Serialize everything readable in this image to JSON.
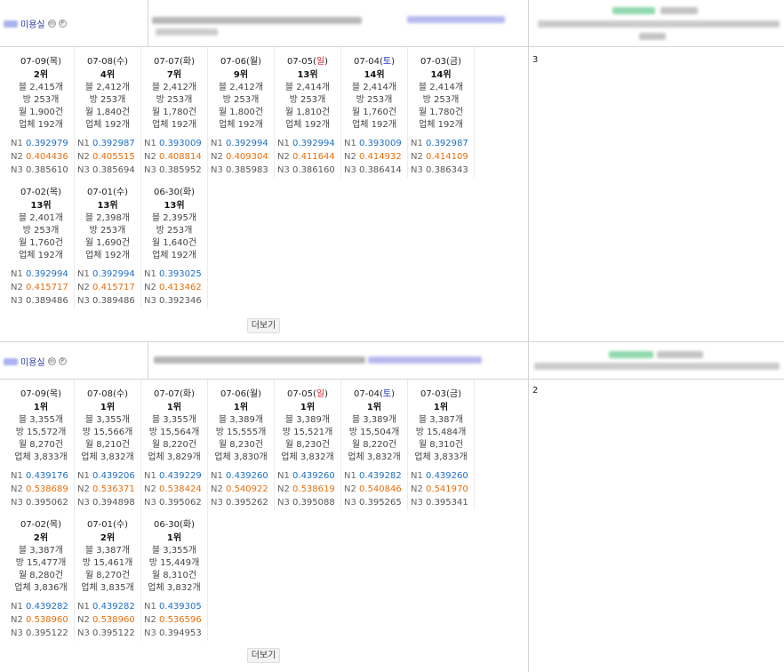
{
  "stores": [
    {
      "name_label": "미용실",
      "badges": [
        "m",
        "P"
      ],
      "right_count": "3",
      "more_label": "더보기",
      "days": [
        {
          "date": "07-09(",
          "wd": "목",
          "close": ")",
          "wd_type": "",
          "rank": "2위",
          "blog": "블 2,415개",
          "bang": "방 253개",
          "month": "월 1,900건",
          "biz": "업체 192개",
          "n1": "0.392979",
          "n2": "0.404436",
          "n3": "0.385610"
        },
        {
          "date": "07-08(",
          "wd": "수",
          "close": ")",
          "wd_type": "",
          "rank": "4위",
          "blog": "블 2,412개",
          "bang": "방 253개",
          "month": "월 1,840건",
          "biz": "업체 192개",
          "n1": "0.392987",
          "n2": "0.405515",
          "n3": "0.385694"
        },
        {
          "date": "07-07(",
          "wd": "화",
          "close": ")",
          "wd_type": "",
          "rank": "7위",
          "blog": "블 2,412개",
          "bang": "방 253개",
          "month": "월 1,780건",
          "biz": "업체 192개",
          "n1": "0.393009",
          "n2": "0.408814",
          "n3": "0.385952"
        },
        {
          "date": "07-06(",
          "wd": "월",
          "close": ")",
          "wd_type": "",
          "rank": "9위",
          "blog": "블 2,412개",
          "bang": "방 253개",
          "month": "월 1,800건",
          "biz": "업체 192개",
          "n1": "0.392994",
          "n2": "0.409304",
          "n3": "0.385983"
        },
        {
          "date": "07-05(",
          "wd": "일",
          "close": ")",
          "wd_type": "sun",
          "rank": "13위",
          "blog": "블 2,414개",
          "bang": "방 253개",
          "month": "월 1,810건",
          "biz": "업체 192개",
          "n1": "0.392994",
          "n2": "0.411644",
          "n3": "0.386160"
        },
        {
          "date": "07-04(",
          "wd": "토",
          "close": ")",
          "wd_type": "sat",
          "rank": "14위",
          "blog": "블 2,414개",
          "bang": "방 253개",
          "month": "월 1,760건",
          "biz": "업체 192개",
          "n1": "0.393009",
          "n2": "0.414932",
          "n3": "0.386414"
        },
        {
          "date": "07-03(",
          "wd": "금",
          "close": ")",
          "wd_type": "",
          "rank": "14위",
          "blog": "블 2,414개",
          "bang": "방 253개",
          "month": "월 1,780건",
          "biz": "업체 192개",
          "n1": "0.392987",
          "n2": "0.414109",
          "n3": "0.386343"
        },
        {
          "date": "07-02(",
          "wd": "목",
          "close": ")",
          "wd_type": "",
          "rank": "13위",
          "blog": "블 2,401개",
          "bang": "방 253개",
          "month": "월 1,760건",
          "biz": "업체 192개",
          "n1": "0.392994",
          "n2": "0.415717",
          "n3": "0.389486"
        },
        {
          "date": "07-01(",
          "wd": "수",
          "close": ")",
          "wd_type": "",
          "rank": "13위",
          "blog": "블 2,398개",
          "bang": "방 253개",
          "month": "월 1,690건",
          "biz": "업체 192개",
          "n1": "0.392994",
          "n2": "0.415717",
          "n3": "0.389486"
        },
        {
          "date": "06-30(",
          "wd": "화",
          "close": ")",
          "wd_type": "",
          "rank": "13위",
          "blog": "블 2,395개",
          "bang": "방 253개",
          "month": "월 1,640건",
          "biz": "업체 192개",
          "n1": "0.393025",
          "n2": "0.413462",
          "n3": "0.392346"
        }
      ]
    },
    {
      "name_label": "미용실",
      "badges": [
        "m",
        "P"
      ],
      "right_count": "2",
      "more_label": "더보기",
      "days": [
        {
          "date": "07-09(",
          "wd": "목",
          "close": ")",
          "wd_type": "",
          "rank": "1위",
          "blog": "블 3,355개",
          "bang": "방 15,572개",
          "month": "월 8,270건",
          "biz": "업체 3,833개",
          "n1": "0.439176",
          "n2": "0.538689",
          "n3": "0.395062"
        },
        {
          "date": "07-08(",
          "wd": "수",
          "close": ")",
          "wd_type": "",
          "rank": "1위",
          "blog": "블 3,355개",
          "bang": "방 15,566개",
          "month": "월 8,210건",
          "biz": "업체 3,832개",
          "n1": "0.439206",
          "n2": "0.536371",
          "n3": "0.394898"
        },
        {
          "date": "07-07(",
          "wd": "화",
          "close": ")",
          "wd_type": "",
          "rank": "1위",
          "blog": "블 3,355개",
          "bang": "방 15,564개",
          "month": "월 8,220건",
          "biz": "업체 3,829개",
          "n1": "0.439229",
          "n2": "0.538424",
          "n3": "0.395062"
        },
        {
          "date": "07-06(",
          "wd": "월",
          "close": ")",
          "wd_type": "",
          "rank": "1위",
          "blog": "블 3,389개",
          "bang": "방 15,555개",
          "month": "월 8,230건",
          "biz": "업체 3,830개",
          "n1": "0.439260",
          "n2": "0.540922",
          "n3": "0.395262"
        },
        {
          "date": "07-05(",
          "wd": "일",
          "close": ")",
          "wd_type": "sun",
          "rank": "1위",
          "blog": "블 3,389개",
          "bang": "방 15,521개",
          "month": "월 8,230건",
          "biz": "업체 3,832개",
          "n1": "0.439260",
          "n2": "0.538619",
          "n3": "0.395088"
        },
        {
          "date": "07-04(",
          "wd": "토",
          "close": ")",
          "wd_type": "sat",
          "rank": "1위",
          "blog": "블 3,389개",
          "bang": "방 15,504개",
          "month": "월 8,220건",
          "biz": "업체 3,832개",
          "n1": "0.439282",
          "n2": "0.540846",
          "n3": "0.395265"
        },
        {
          "date": "07-03(",
          "wd": "금",
          "close": ")",
          "wd_type": "",
          "rank": "1위",
          "blog": "블 3,387개",
          "bang": "방 15,484개",
          "month": "월 8,310건",
          "biz": "업체 3,833개",
          "n1": "0.439260",
          "n2": "0.541970",
          "n3": "0.395341"
        },
        {
          "date": "07-02(",
          "wd": "목",
          "close": ")",
          "wd_type": "",
          "rank": "2위",
          "blog": "블 3,387개",
          "bang": "방 15,477개",
          "month": "월 8,280건",
          "biz": "업체 3,836개",
          "n1": "0.439282",
          "n2": "0.538960",
          "n3": "0.395122"
        },
        {
          "date": "07-01(",
          "wd": "수",
          "close": ")",
          "wd_type": "",
          "rank": "2위",
          "blog": "블 3,387개",
          "bang": "방 15,461개",
          "month": "월 8,270건",
          "biz": "업체 3,835개",
          "n1": "0.439282",
          "n2": "0.538960",
          "n3": "0.395122"
        },
        {
          "date": "06-30(",
          "wd": "화",
          "close": ")",
          "wd_type": "",
          "rank": "1위",
          "blog": "블 3,355개",
          "bang": "방 15,449개",
          "month": "월 8,310건",
          "biz": "업체 3,832개",
          "n1": "0.439305",
          "n2": "0.536596",
          "n3": "0.394953"
        }
      ]
    }
  ],
  "n_labels": {
    "n1": "N1",
    "n2": "N2",
    "n3": "N3"
  },
  "colors": {
    "n1": "#1d6fc4",
    "n2": "#e76e0c",
    "sunday": "#e0202b",
    "saturday": "#2233cc"
  }
}
